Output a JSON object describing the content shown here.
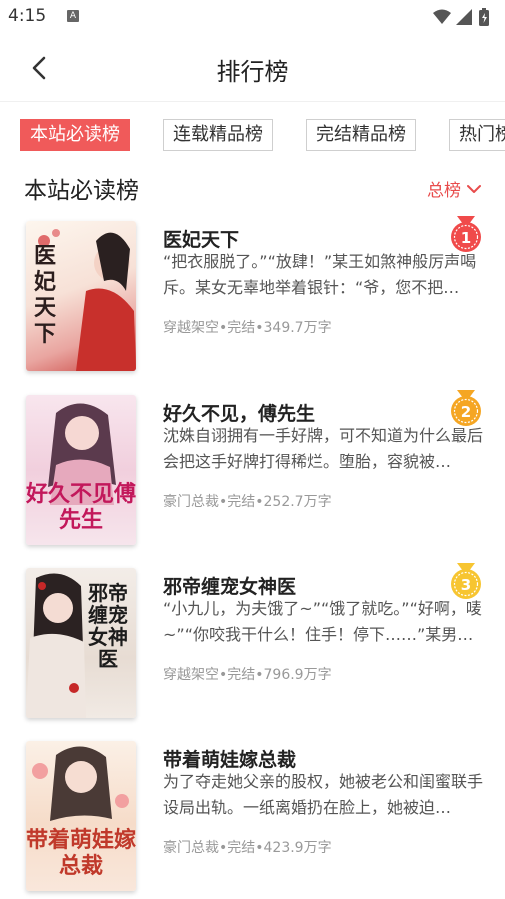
{
  "status_bar": {
    "time": "4:15",
    "a_icon": "A"
  },
  "nav": {
    "title": "排行榜"
  },
  "tabs": [
    "本站必读榜",
    "连载精品榜",
    "完结精品榜",
    "热门榜"
  ],
  "section": {
    "title": "本站必读榜",
    "sort_label": "总榜"
  },
  "books": [
    {
      "title": "医妃天下",
      "desc": "“把衣服脱了。”“放肆！”某王如煞神般厉声喝斥。某女无辜地举着银针：“爷，您不把…",
      "meta": "穿越架空•完结•349.7万字",
      "rank": "1",
      "cover_text": "医妃天下",
      "badge_color": "#f04a4a"
    },
    {
      "title": "好久不见，傅先生",
      "desc": "沈姝自诩拥有一手好牌，可不知道为什么最后会把这手好牌打得稀烂。堕胎，容貌被…",
      "meta": "豪门总裁•完结•252.7万字",
      "rank": "2",
      "cover_text": "好久不见傅先生",
      "badge_color": "#f5a623"
    },
    {
      "title": "邪帝缠宠女神医",
      "desc": "“小九儿，为夫饿了~”“饿了就吃。”“好啊，唛~”“你咬我干什么！住手！停下……”某男…",
      "meta": "穿越架空•完结•796.9万字",
      "rank": "3",
      "cover_text": "邪帝缠宠女神医",
      "badge_color": "#f7c531"
    },
    {
      "title": "带着萌娃嫁总裁",
      "desc": "为了夺走她父亲的股权，她被老公和闺蜜联手设局出轨。一纸离婚扔在脸上，她被迫…",
      "meta": "豪门总裁•完结•423.9万字",
      "rank": "",
      "cover_text": "带着萌娃嫁总裁",
      "badge_color": ""
    }
  ]
}
